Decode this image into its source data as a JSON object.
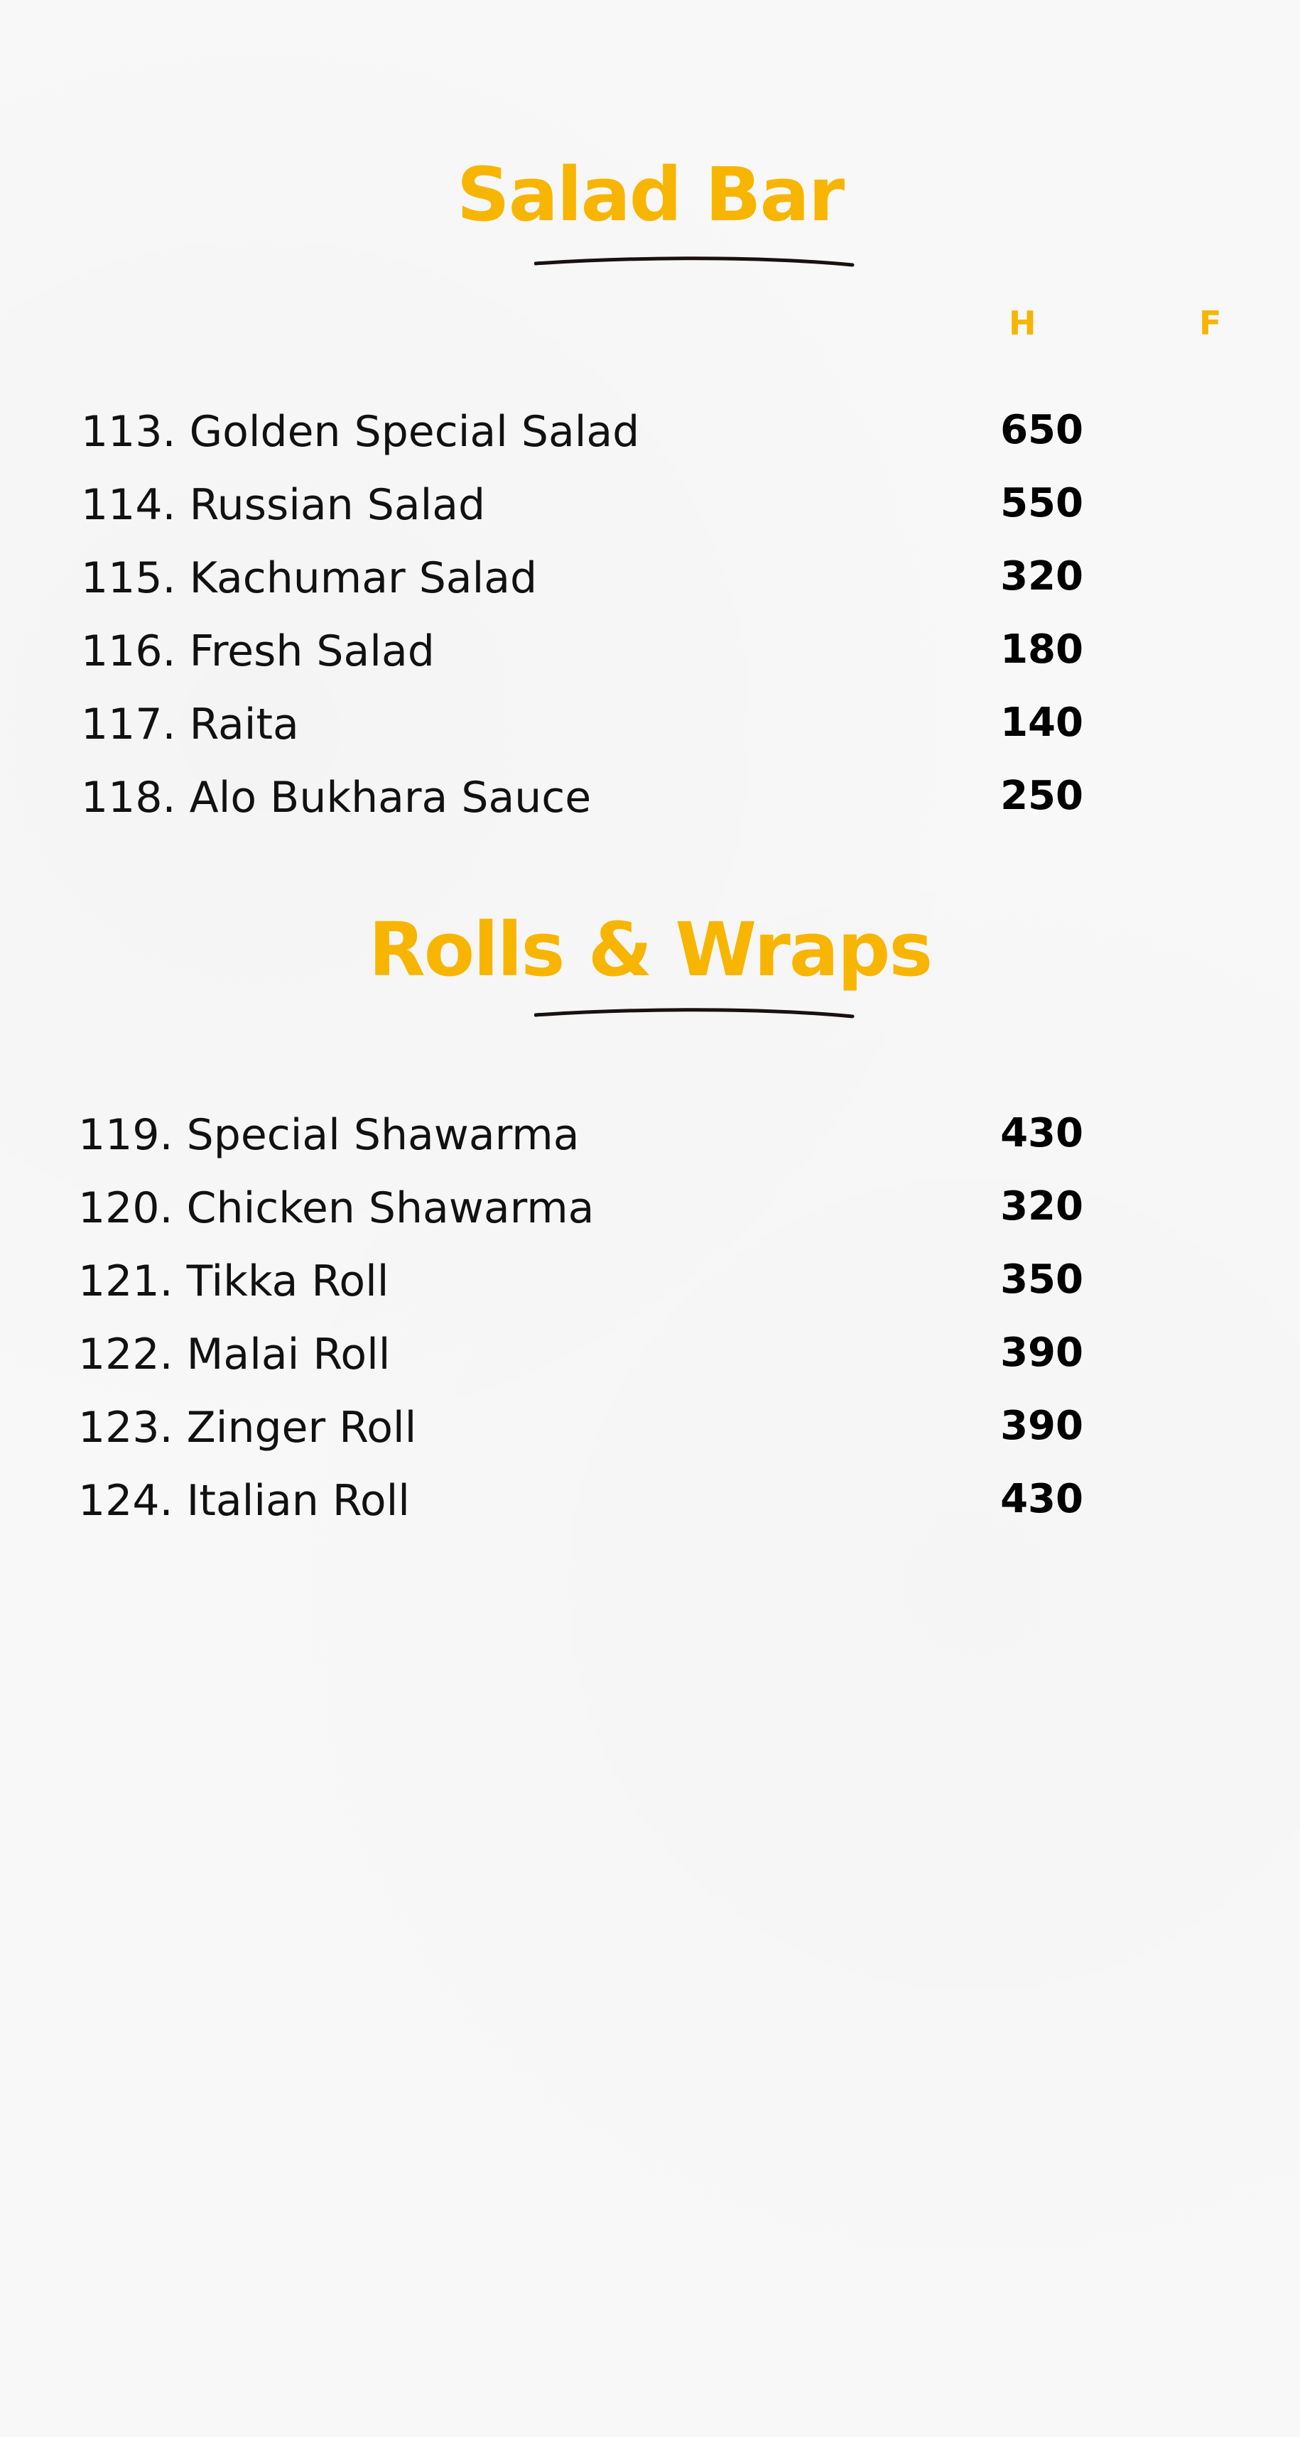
{
  "salad_bar": {
    "title": "Salad Bar",
    "col_half": "H",
    "col_full": "F",
    "items": [
      {
        "name": "113. Golden Special Salad",
        "price": "650"
      },
      {
        "name": "114. Russian Salad",
        "price": "550"
      },
      {
        "name": "115. Kachumar Salad",
        "price": "320"
      },
      {
        "name": "116. Fresh Salad",
        "price": "180"
      },
      {
        "name": "117. Raita",
        "price": "140"
      },
      {
        "name": "118. Alo Bukhara Sauce",
        "price": "250"
      }
    ]
  },
  "rolls_wraps": {
    "title": "Rolls & Wraps",
    "items": [
      {
        "name": "119. Special Shawarma",
        "price": "430"
      },
      {
        "name": "120. Chicken Shawarma",
        "price": "320"
      },
      {
        "name": "121. Tikka Roll",
        "price": "350"
      },
      {
        "name": "122. Malai Roll",
        "price": "390"
      },
      {
        "name": "123. Zinger Roll",
        "price": "390"
      },
      {
        "name": "124. Italian Roll",
        "price": "430"
      }
    ]
  },
  "colors": {
    "accent": "#f7b500",
    "text": "#111111",
    "underline": "#1a1010",
    "background": "#f8f8f8"
  }
}
